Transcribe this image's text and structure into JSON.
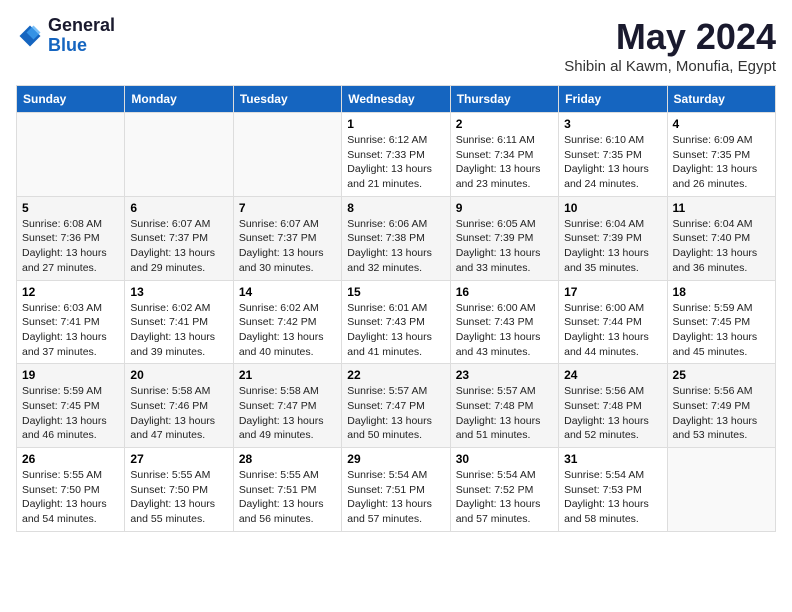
{
  "header": {
    "logo_general": "General",
    "logo_blue": "Blue",
    "title": "May 2024",
    "location": "Shibin al Kawm, Monufia, Egypt"
  },
  "weekdays": [
    "Sunday",
    "Monday",
    "Tuesday",
    "Wednesday",
    "Thursday",
    "Friday",
    "Saturday"
  ],
  "weeks": [
    [
      {
        "day": null
      },
      {
        "day": null
      },
      {
        "day": null
      },
      {
        "day": "1",
        "sunrise": "6:12 AM",
        "sunset": "7:33 PM",
        "daylight": "13 hours and 21 minutes."
      },
      {
        "day": "2",
        "sunrise": "6:11 AM",
        "sunset": "7:34 PM",
        "daylight": "13 hours and 23 minutes."
      },
      {
        "day": "3",
        "sunrise": "6:10 AM",
        "sunset": "7:35 PM",
        "daylight": "13 hours and 24 minutes."
      },
      {
        "day": "4",
        "sunrise": "6:09 AM",
        "sunset": "7:35 PM",
        "daylight": "13 hours and 26 minutes."
      }
    ],
    [
      {
        "day": "5",
        "sunrise": "6:08 AM",
        "sunset": "7:36 PM",
        "daylight": "13 hours and 27 minutes."
      },
      {
        "day": "6",
        "sunrise": "6:07 AM",
        "sunset": "7:37 PM",
        "daylight": "13 hours and 29 minutes."
      },
      {
        "day": "7",
        "sunrise": "6:07 AM",
        "sunset": "7:37 PM",
        "daylight": "13 hours and 30 minutes."
      },
      {
        "day": "8",
        "sunrise": "6:06 AM",
        "sunset": "7:38 PM",
        "daylight": "13 hours and 32 minutes."
      },
      {
        "day": "9",
        "sunrise": "6:05 AM",
        "sunset": "7:39 PM",
        "daylight": "13 hours and 33 minutes."
      },
      {
        "day": "10",
        "sunrise": "6:04 AM",
        "sunset": "7:39 PM",
        "daylight": "13 hours and 35 minutes."
      },
      {
        "day": "11",
        "sunrise": "6:04 AM",
        "sunset": "7:40 PM",
        "daylight": "13 hours and 36 minutes."
      }
    ],
    [
      {
        "day": "12",
        "sunrise": "6:03 AM",
        "sunset": "7:41 PM",
        "daylight": "13 hours and 37 minutes."
      },
      {
        "day": "13",
        "sunrise": "6:02 AM",
        "sunset": "7:41 PM",
        "daylight": "13 hours and 39 minutes."
      },
      {
        "day": "14",
        "sunrise": "6:02 AM",
        "sunset": "7:42 PM",
        "daylight": "13 hours and 40 minutes."
      },
      {
        "day": "15",
        "sunrise": "6:01 AM",
        "sunset": "7:43 PM",
        "daylight": "13 hours and 41 minutes."
      },
      {
        "day": "16",
        "sunrise": "6:00 AM",
        "sunset": "7:43 PM",
        "daylight": "13 hours and 43 minutes."
      },
      {
        "day": "17",
        "sunrise": "6:00 AM",
        "sunset": "7:44 PM",
        "daylight": "13 hours and 44 minutes."
      },
      {
        "day": "18",
        "sunrise": "5:59 AM",
        "sunset": "7:45 PM",
        "daylight": "13 hours and 45 minutes."
      }
    ],
    [
      {
        "day": "19",
        "sunrise": "5:59 AM",
        "sunset": "7:45 PM",
        "daylight": "13 hours and 46 minutes."
      },
      {
        "day": "20",
        "sunrise": "5:58 AM",
        "sunset": "7:46 PM",
        "daylight": "13 hours and 47 minutes."
      },
      {
        "day": "21",
        "sunrise": "5:58 AM",
        "sunset": "7:47 PM",
        "daylight": "13 hours and 49 minutes."
      },
      {
        "day": "22",
        "sunrise": "5:57 AM",
        "sunset": "7:47 PM",
        "daylight": "13 hours and 50 minutes."
      },
      {
        "day": "23",
        "sunrise": "5:57 AM",
        "sunset": "7:48 PM",
        "daylight": "13 hours and 51 minutes."
      },
      {
        "day": "24",
        "sunrise": "5:56 AM",
        "sunset": "7:48 PM",
        "daylight": "13 hours and 52 minutes."
      },
      {
        "day": "25",
        "sunrise": "5:56 AM",
        "sunset": "7:49 PM",
        "daylight": "13 hours and 53 minutes."
      }
    ],
    [
      {
        "day": "26",
        "sunrise": "5:55 AM",
        "sunset": "7:50 PM",
        "daylight": "13 hours and 54 minutes."
      },
      {
        "day": "27",
        "sunrise": "5:55 AM",
        "sunset": "7:50 PM",
        "daylight": "13 hours and 55 minutes."
      },
      {
        "day": "28",
        "sunrise": "5:55 AM",
        "sunset": "7:51 PM",
        "daylight": "13 hours and 56 minutes."
      },
      {
        "day": "29",
        "sunrise": "5:54 AM",
        "sunset": "7:51 PM",
        "daylight": "13 hours and 57 minutes."
      },
      {
        "day": "30",
        "sunrise": "5:54 AM",
        "sunset": "7:52 PM",
        "daylight": "13 hours and 57 minutes."
      },
      {
        "day": "31",
        "sunrise": "5:54 AM",
        "sunset": "7:53 PM",
        "daylight": "13 hours and 58 minutes."
      },
      {
        "day": null
      }
    ]
  ],
  "labels": {
    "sunrise": "Sunrise:",
    "sunset": "Sunset:",
    "daylight": "Daylight:"
  }
}
